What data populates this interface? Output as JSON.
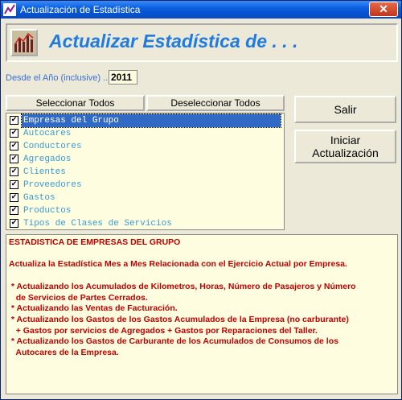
{
  "window": {
    "title": "Actualización de Estadística",
    "close_label": "✕"
  },
  "header": {
    "title": "Actualizar Estadística de . . ."
  },
  "year": {
    "label": "Desde el Año (inclusive) ...",
    "value": "2011"
  },
  "buttons": {
    "select_all": "Seleccionar Todos",
    "deselect_all": "Deseleccionar Todos",
    "exit": "Salir",
    "start_line1": "Iniciar",
    "start_line2": "Actualización"
  },
  "list": {
    "items": [
      {
        "label": "Empresas del Grupo",
        "checked": true,
        "selected": true
      },
      {
        "label": "Autocares",
        "checked": true,
        "selected": false
      },
      {
        "label": "Conductores",
        "checked": true,
        "selected": false
      },
      {
        "label": "Agregados",
        "checked": true,
        "selected": false
      },
      {
        "label": "Clientes",
        "checked": true,
        "selected": false
      },
      {
        "label": "Proveedores",
        "checked": true,
        "selected": false
      },
      {
        "label": "Gastos",
        "checked": true,
        "selected": false
      },
      {
        "label": "Productos",
        "checked": true,
        "selected": false
      },
      {
        "label": "Tipos de Clases de Servicios",
        "checked": true,
        "selected": false
      }
    ]
  },
  "description": {
    "lines": [
      "ESTADISTICA DE EMPRESAS DEL GRUPO",
      "",
      "Actualiza la Estadística Mes a Mes Relacionada con el Ejercicio Actual por Empresa.",
      "",
      " * Actualizando los Acumulados de Kilometros, Horas, Número de Pasajeros y Número",
      "   de Servicios de Partes Cerrados.",
      " * Actualizando las Ventas de Facturación.",
      " * Actualizando los Gastos de los Gastos Acumulados de la Empresa (no carburante)",
      "   + Gastos por servicios de Agregados + Gastos por Reparaciones del Taller.",
      " * Actualizando los Gastos de Carburante de los Acumulados de Consumos de los",
      "   Autocares de la Empresa."
    ]
  },
  "colors": {
    "title_blue": "#1f7be0",
    "desc_red": "#c00000",
    "list_text": "#3a9bd0",
    "selection": "#316ac5"
  }
}
